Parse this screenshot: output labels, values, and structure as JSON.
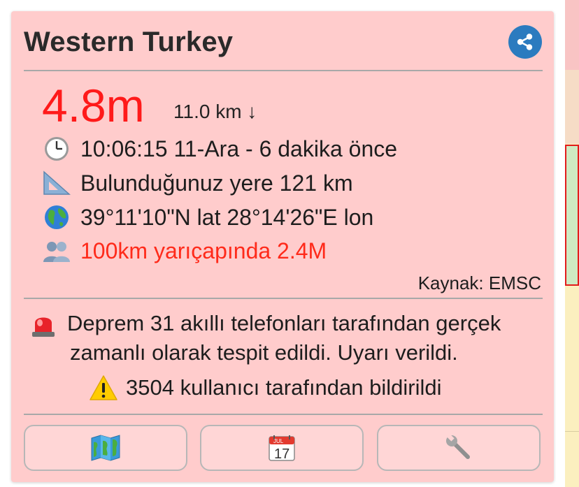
{
  "card": {
    "title": "Western Turkey",
    "magnitude": "4.8m",
    "depth": "11.0 km ↓",
    "time": "10:06:15 11-Ara - 6 dakika önce",
    "distance": "Bulunduğunuz yere 121 km",
    "coordinates": "39°11'10\"N lat 28°14'26\"E lon",
    "population": "100km yarıçapında 2.4M",
    "source": "Kaynak: EMSC",
    "alert_line1": "Deprem 31 akıllı telefonları tarafından gerçek",
    "alert_line2": "zamanlı olarak tespit edildi. Uyarı verildi.",
    "reports": "3504 kullanıcı tarafından bildirildi",
    "calendar_month": "JUL",
    "calendar_day": "17"
  },
  "icons": {
    "share": "share-icon",
    "clock": "clock-icon",
    "ruler": "ruler-icon",
    "globe": "globe-icon",
    "people": "people-icon",
    "siren": "siren-icon",
    "warning": "warning-icon",
    "map": "map-icon",
    "calendar": "calendar-icon",
    "wrench": "wrench-icon"
  },
  "colors": {
    "card_bg": "#ffcccc",
    "magnitude": "#ff1a1a",
    "population": "#ff2a1a",
    "share_btn": "#2b7bbf"
  }
}
